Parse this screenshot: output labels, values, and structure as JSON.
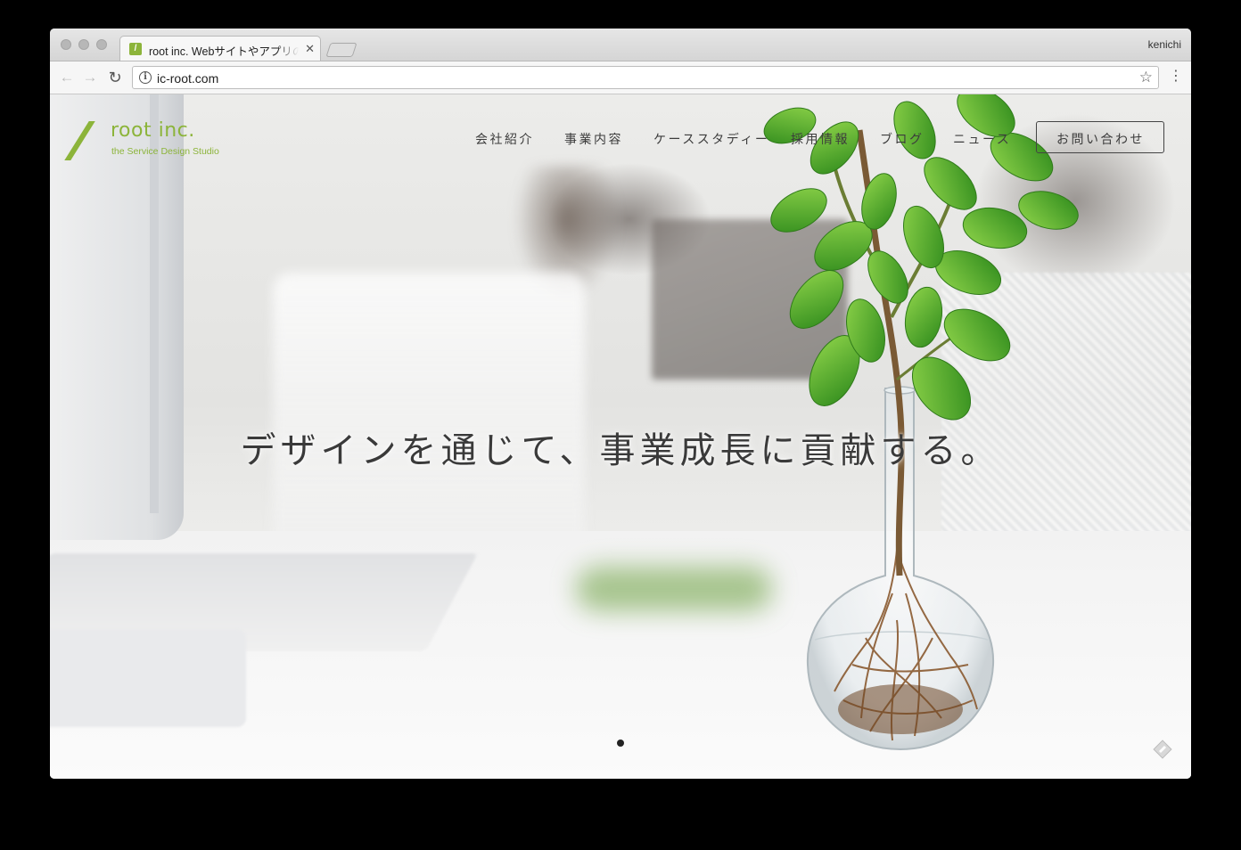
{
  "browser": {
    "tab_title": "root inc. Webサイトやアプリのサービスデザイン",
    "tab_favicon": "/",
    "tab_close": "✕",
    "profile_name": "kenichi",
    "url": "ic-root.com",
    "icons": {
      "back": "←",
      "forward": "→",
      "reload": "↻",
      "info": "i",
      "star": "☆",
      "menu": "⋮"
    }
  },
  "site": {
    "logo": {
      "name": "root inc.",
      "tagline": "the Service Design Studio"
    },
    "nav": [
      {
        "label": "会社紹介"
      },
      {
        "label": "事業内容"
      },
      {
        "label": "ケーススタディー"
      },
      {
        "label": "採用情報"
      },
      {
        "label": "ブログ"
      },
      {
        "label": "ニュース"
      }
    ],
    "contact_label": "お問い合わせ",
    "catchphrase": "デザインを通じて、事業成長に貢献する。",
    "carousel_current": 1
  },
  "colors": {
    "brand_green": "#8cb43a"
  }
}
